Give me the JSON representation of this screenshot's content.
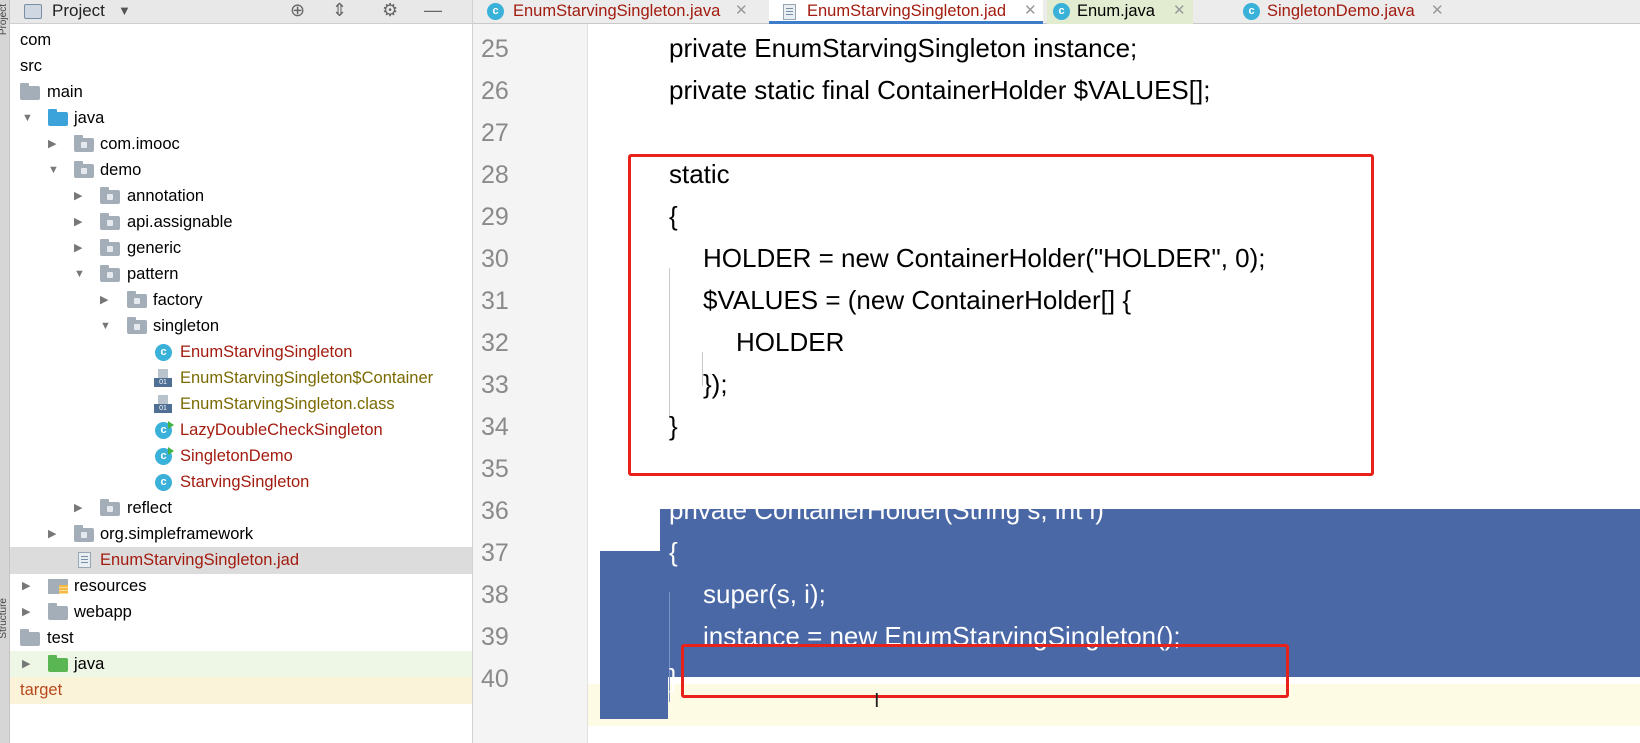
{
  "sidebar_strip": {
    "top_label": "Project",
    "bottom_label": "Structure"
  },
  "project_panel": {
    "title": "Project",
    "tree": [
      {
        "label": "com",
        "color": "#7a6a00"
      },
      {
        "label": "src",
        "color": "#000000"
      },
      {
        "label": "main",
        "color": "#000000"
      },
      {
        "label": "java",
        "color": "#000000"
      },
      {
        "label": "com.imooc",
        "color": "#000000"
      },
      {
        "label": "demo",
        "color": "#000000"
      },
      {
        "label": "annotation",
        "color": "#000000"
      },
      {
        "label": "api.assignable",
        "color": "#000000"
      },
      {
        "label": "generic",
        "color": "#000000"
      },
      {
        "label": "pattern",
        "color": "#000000"
      },
      {
        "label": "factory",
        "color": "#000000"
      },
      {
        "label": "singleton",
        "color": "#000000"
      },
      {
        "label": "EnumStarvingSingleton",
        "color": "#a21b0f"
      },
      {
        "label": "EnumStarvingSingleton$Container",
        "color": "#7a6a00"
      },
      {
        "label": "EnumStarvingSingleton.class",
        "color": "#7a6a00"
      },
      {
        "label": "LazyDoubleCheckSingleton",
        "color": "#a21b0f"
      },
      {
        "label": "SingletonDemo",
        "color": "#a21b0f"
      },
      {
        "label": "StarvingSingleton",
        "color": "#a21b0f"
      },
      {
        "label": "reflect",
        "color": "#000000"
      },
      {
        "label": "org.simpleframework",
        "color": "#000000"
      },
      {
        "label": "EnumStarvingSingleton.jad",
        "color": "#a21b0f"
      },
      {
        "label": "resources",
        "color": "#000000"
      },
      {
        "label": "webapp",
        "color": "#000000"
      },
      {
        "label": "test",
        "color": "#000000"
      },
      {
        "label": "java",
        "color": "#000000"
      },
      {
        "label": "target",
        "color": "#b8481b"
      }
    ]
  },
  "tabs": [
    {
      "label": "EnumStarvingSingleton.java",
      "color": "#a21b0f"
    },
    {
      "label": "EnumStarvingSingleton.jad",
      "color": "#a21b0f"
    },
    {
      "label": "Enum.java",
      "color": "#000000"
    },
    {
      "label": "SingletonDemo.java",
      "color": "#a21b0f"
    }
  ],
  "editor": {
    "line_numbers": [
      "25",
      "26",
      "27",
      "28",
      "29",
      "30",
      "31",
      "32",
      "33",
      "34",
      "35",
      "36",
      "37",
      "38",
      "39",
      "40"
    ],
    "lines": [
      "private EnumStarvingSingleton instance;",
      "private static final ContainerHolder $VALUES[];",
      "",
      "static",
      "{",
      "HOLDER = new ContainerHolder(\"HOLDER\", 0);",
      "$VALUES = (new ContainerHolder[] {",
      "HOLDER",
      "});",
      "}",
      "",
      "private ContainerHolder(String s, int i)",
      "{",
      "super(s, i);",
      "instance = new EnumStarvingSingleton();",
      "}"
    ]
  },
  "colors": {
    "selection": "#4a67a6",
    "annotation": "#e8211b",
    "active_tab_underline": "#3d7cc9"
  }
}
